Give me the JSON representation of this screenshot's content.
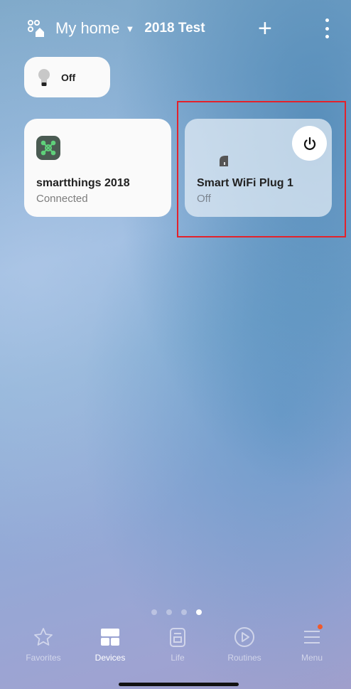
{
  "header": {
    "home_label": "My home",
    "room_label": "2018 Test"
  },
  "chip": {
    "label": "Off"
  },
  "devices": [
    {
      "name": "smartthings 2018",
      "status": "Connected"
    },
    {
      "name": "Smart WiFi Plug 1",
      "status": "Off"
    }
  ],
  "pagination": {
    "total": 4,
    "active_index": 3
  },
  "tabs": [
    {
      "label": "Favorites",
      "icon": "star-icon"
    },
    {
      "label": "Devices",
      "icon": "devices-icon"
    },
    {
      "label": "Life",
      "icon": "life-icon"
    },
    {
      "label": "Routines",
      "icon": "routines-icon"
    },
    {
      "label": "Menu",
      "icon": "menu-icon"
    }
  ],
  "colors": {
    "highlight": "#e3222b",
    "hub_icon_bg": "#4a5b52",
    "hub_icon_fg": "#5fd07a",
    "badge": "#f15a2b"
  }
}
